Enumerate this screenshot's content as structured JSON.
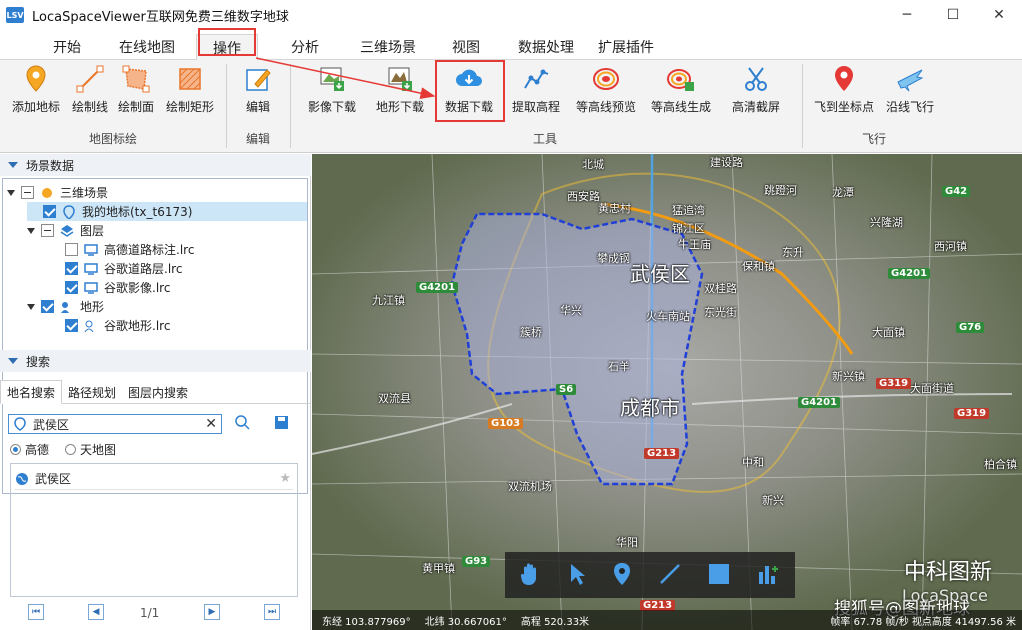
{
  "window": {
    "title": "LocaSpaceViewer互联网免费三维数字地球",
    "app_icon_text": "LSV",
    "minimize": "─",
    "maximize": "☐",
    "close": "✕"
  },
  "tabs": [
    {
      "label": "开始"
    },
    {
      "label": "在线地图"
    },
    {
      "label": "操作"
    },
    {
      "label": "分析"
    },
    {
      "label": "三维场景"
    },
    {
      "label": "视图"
    },
    {
      "label": "数据处理"
    },
    {
      "label": "扩展插件"
    }
  ],
  "active_tab": "操作",
  "ribbon": {
    "groups": [
      {
        "label": "地图标绘"
      },
      {
        "label": "编辑"
      },
      {
        "label": "工具"
      },
      {
        "label": "飞行"
      }
    ],
    "buttons": [
      {
        "label": "添加地标",
        "icon": "placemark-icon"
      },
      {
        "label": "绘制线",
        "icon": "draw-line-icon"
      },
      {
        "label": "绘制面",
        "icon": "draw-polygon-icon"
      },
      {
        "label": "绘制矩形",
        "icon": "draw-rectangle-icon"
      },
      {
        "label": "编辑",
        "icon": "edit-icon"
      },
      {
        "label": "影像下载",
        "icon": "image-download-icon"
      },
      {
        "label": "地形下载",
        "icon": "terrain-download-icon"
      },
      {
        "label": "数据下载",
        "icon": "cloud-download-icon"
      },
      {
        "label": "提取高程",
        "icon": "extract-elevation-icon"
      },
      {
        "label": "等高线预览",
        "icon": "contour-preview-icon"
      },
      {
        "label": "等高线生成",
        "icon": "contour-generate-icon"
      },
      {
        "label": "高清截屏",
        "icon": "screenshot-icon"
      },
      {
        "label": "飞到坐标点",
        "icon": "fly-to-point-icon"
      },
      {
        "label": "沿线飞行",
        "icon": "fly-along-line-icon"
      }
    ],
    "highlight_color": "#e53935"
  },
  "scene_panel": {
    "header": "场景数据",
    "tree": [
      {
        "label": "三维场景",
        "checked": "partial",
        "icon": "scene-icon"
      },
      {
        "label": "我的地标(tx_t6173)",
        "checked": true,
        "icon": "placemark-icon",
        "selected": true
      },
      {
        "label": "图层",
        "checked": "partial",
        "icon": "layers-icon"
      },
      {
        "label": "高德道路标注.lrc",
        "checked": false,
        "icon": "monitor-icon"
      },
      {
        "label": "谷歌道路层.lrc",
        "checked": true,
        "icon": "monitor-icon"
      },
      {
        "label": "谷歌影像.lrc",
        "checked": true,
        "icon": "monitor-icon"
      },
      {
        "label": "地形",
        "checked": true,
        "icon": "terrain-icon"
      },
      {
        "label": "谷歌地形.lrc",
        "checked": true,
        "icon": "terrain-icon"
      }
    ]
  },
  "search_panel": {
    "header": "搜索",
    "tabs": [
      "地名搜索",
      "路径规划",
      "图层内搜索"
    ],
    "query": "武侯区",
    "clear": "✕",
    "sources": [
      "高德",
      "天地图"
    ],
    "selected_source": "高德",
    "results": [
      {
        "label": "武侯区"
      }
    ],
    "pager": {
      "first": "⏮",
      "prev": "◀",
      "page": "1/1",
      "next": "▶",
      "last": "⏭"
    }
  },
  "map": {
    "district_label": "武侯区",
    "city_label": "成都市",
    "labels": [
      "北城",
      "西安路",
      "黄忠村",
      "猛追湾",
      "建设路",
      "跳蹬河",
      "龙潭",
      "锦江区",
      "牛王庙",
      "攀成钢",
      "保和镇",
      "双桂路",
      "东光街",
      "火车南站",
      "华兴",
      "簇桥",
      "石羊",
      "兴隆湖",
      "双流县",
      "九江镇",
      "华阳",
      "西河镇",
      "新兴镇",
      "大面镇",
      "柏合镇",
      "中和",
      "双流机场",
      "东升",
      "新兴",
      "大面街道",
      "黄甲镇"
    ],
    "shields": [
      {
        "text": "G42",
        "kind": "green"
      },
      {
        "text": "G4201",
        "kind": "green"
      },
      {
        "text": "G76",
        "kind": "green"
      },
      {
        "text": "G319",
        "kind": "red"
      },
      {
        "text": "G4201",
        "kind": "green"
      },
      {
        "text": "G319",
        "kind": "red"
      },
      {
        "text": "G4201",
        "kind": "green"
      },
      {
        "text": "S6",
        "kind": "green"
      },
      {
        "text": "G103",
        "kind": "orange"
      },
      {
        "text": "G213",
        "kind": "red"
      },
      {
        "text": "G93",
        "kind": "green"
      },
      {
        "text": "G213",
        "kind": "red"
      }
    ],
    "tools": [
      "pan-hand-icon",
      "select-arrow-icon",
      "placemark-icon",
      "draw-line-icon",
      "draw-rectangle-icon",
      "measure-icon"
    ],
    "status": {
      "longitude": "东经 103.877969°",
      "latitude": "北纬 30.667061°",
      "elevation": "高程 520.33米",
      "frame": "帧率 67.78 帧/秒 视点高度 41497.56 米"
    },
    "watermark_company": "中科图新",
    "watermark_brand": "LocaSpace",
    "watermark_source": "搜狐号@图新地球"
  }
}
